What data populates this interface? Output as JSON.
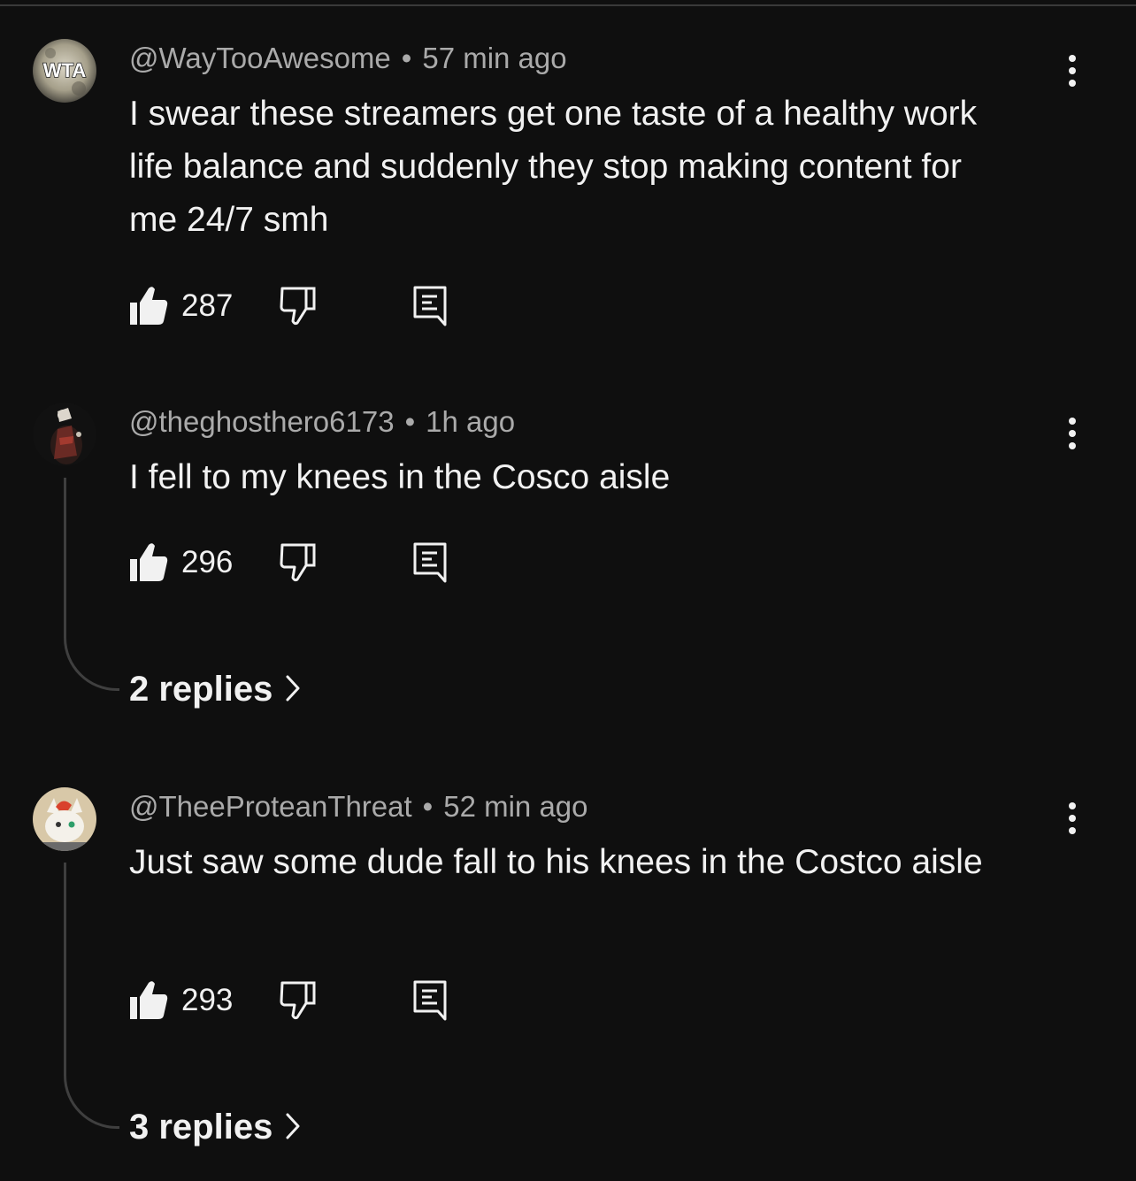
{
  "comments": [
    {
      "avatar_text": "WTA",
      "author": "@WayTooAwesome",
      "time": "57 min ago",
      "text": "I swear these streamers get one taste of a healthy work life balance and suddenly they stop making content for me 24/7 smh",
      "likes": "287"
    },
    {
      "author": "@theghosthero6173",
      "time": "1h ago",
      "text": "I fell to my knees in the Cosco aisle",
      "likes": "296",
      "replies": "2 replies"
    },
    {
      "author": "@TheeProteanThreat",
      "time": "52 min ago",
      "text": "Just saw some dude fall to his knees in the Costco aisle",
      "likes": "293",
      "replies": "3 replies"
    }
  ],
  "separator": "•",
  "icons": [
    "like-icon",
    "dislike-icon",
    "reply-icon",
    "more-options-icon",
    "chevron-right-icon"
  ]
}
